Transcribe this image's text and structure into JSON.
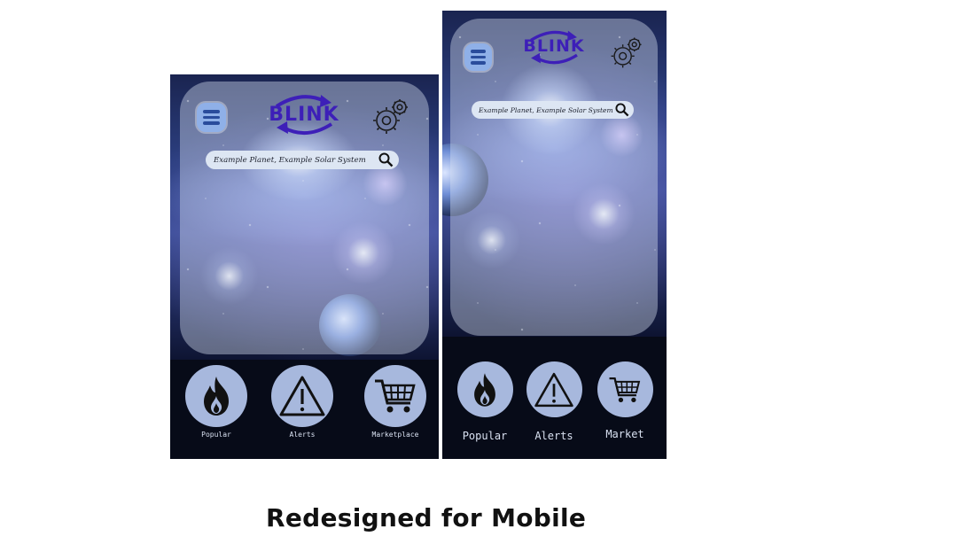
{
  "brand": {
    "logo_text": "BLINK",
    "logo_color": "#3d1fb8"
  },
  "search": {
    "placeholder": "Example Planet, Example Solar System"
  },
  "mockup_left": {
    "nav": [
      {
        "label": "Popular",
        "icon": "flame-icon"
      },
      {
        "label": "Alerts",
        "icon": "warning-icon"
      },
      {
        "label": "Marketplace",
        "icon": "cart-icon"
      }
    ]
  },
  "mockup_right": {
    "nav": [
      {
        "label": "Popular",
        "icon": "flame-icon"
      },
      {
        "label": "Alerts",
        "icon": "warning-icon"
      },
      {
        "label": "Market",
        "icon": "cart-icon"
      }
    ]
  },
  "caption": "Redesigned for Mobile",
  "colors": {
    "nav_circle": "#a7b8dd",
    "nav_bar": "#070b18",
    "menu_button": "#8fb0e8",
    "panel": "rgba(215,225,240,0.42)"
  }
}
